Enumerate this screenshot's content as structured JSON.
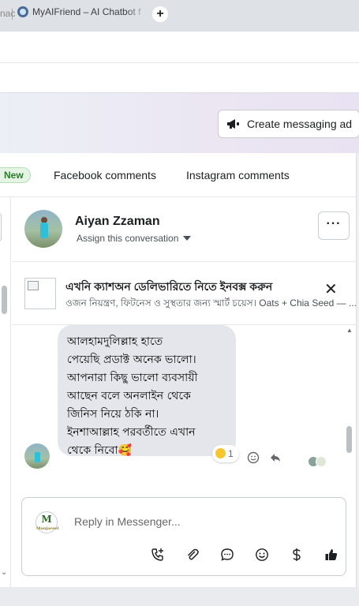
{
  "browser": {
    "prev_tab_fragment": "nac",
    "active_tab_title": "MyAIFriend – AI Chatbot f",
    "new_tab_label": "+"
  },
  "header": {
    "create_ad_label": "Create messaging ad"
  },
  "tabs": {
    "new_badge": "New",
    "facebook": "Facebook comments",
    "instagram": "Instagram comments"
  },
  "conversation": {
    "name": "Aiyan Zzaman",
    "assign_label": "Assign this conversation",
    "more_label": "···"
  },
  "ad_context": {
    "title": "এখনি ক্যাশঅন ডেলিভারিতে নিতে ইনবক্স করুন",
    "subtitle": "ওজন নিয়ন্ত্রণ, ফিটনেস ও সুস্থতার জন্য স্মার্ট চয়েস। Oats + Chia Seed — ...",
    "close_label": "✕"
  },
  "message": {
    "lines": [
      "আলহামদুলিল্লাহ  হাতে",
      "পেয়েছি প্রডাক্ট অনেক ভালো।",
      "আপনারা কিছু ভালো ব্যবসায়ী",
      "আছেন বলে অনলাইন থেকে",
      "জিনিস নিয়ে ঠকি না।",
      "ইনশাআল্লাহ পরবর্তীতে এখান",
      "থেকে নিবো🥰"
    ],
    "reaction_count": "1"
  },
  "reply": {
    "placeholder": "Reply in Messenger...",
    "brand_initial": "M",
    "brand_name": "Manjareel"
  },
  "icons": [
    "messenger-icon",
    "megaphone-icon",
    "call-add-icon",
    "attachment-icon",
    "chat-bubble-icon",
    "emoji-icon",
    "dollar-icon",
    "thumbs-up-icon",
    "reply-icon",
    "close-icon",
    "more-icon"
  ],
  "colors": {
    "accent": "#0866ff",
    "new_badge_bg": "#e6f4e5",
    "bubble_bg": "#e4e6eb"
  }
}
